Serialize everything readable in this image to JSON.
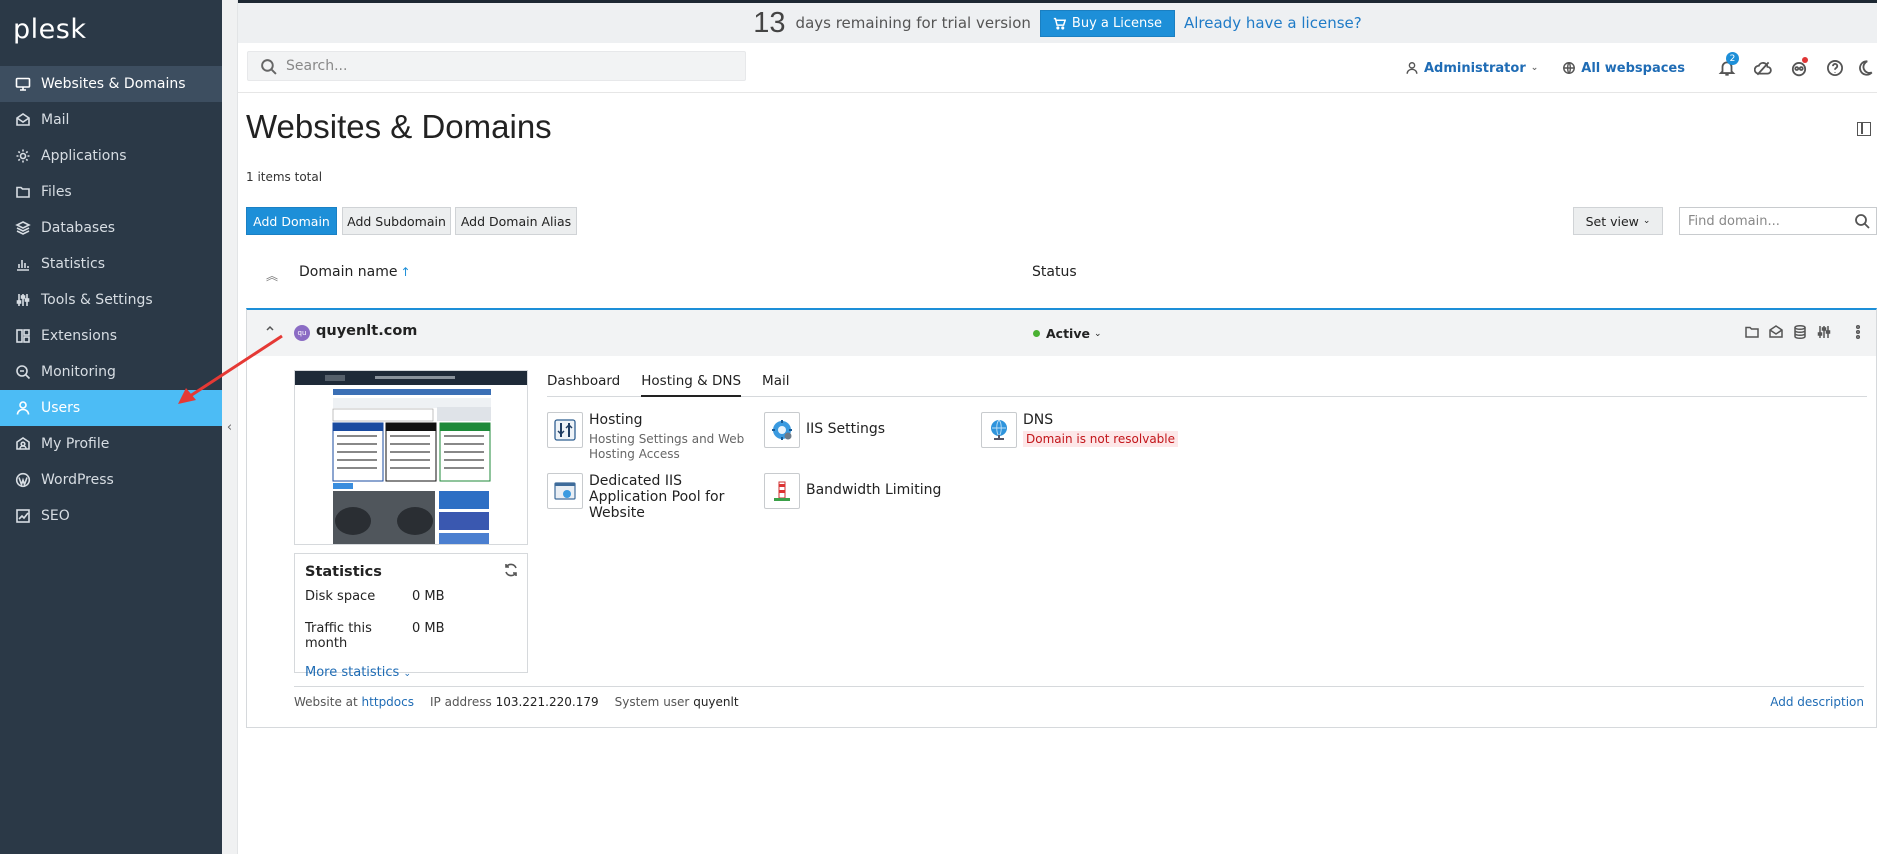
{
  "app": {
    "logo": "plesk"
  },
  "sidebar": {
    "items": [
      {
        "label": "Websites & Domains",
        "icon": "monitor-icon"
      },
      {
        "label": "Mail",
        "icon": "mail-icon"
      },
      {
        "label": "Applications",
        "icon": "gear-icon"
      },
      {
        "label": "Files",
        "icon": "folder-icon"
      },
      {
        "label": "Databases",
        "icon": "layers-icon"
      },
      {
        "label": "Statistics",
        "icon": "bar-chart-icon"
      },
      {
        "label": "Tools & Settings",
        "icon": "sliders-icon"
      },
      {
        "label": "Extensions",
        "icon": "grid-icon"
      },
      {
        "label": "Monitoring",
        "icon": "monitor-search-icon"
      },
      {
        "label": "Users",
        "icon": "user-icon"
      },
      {
        "label": "My Profile",
        "icon": "profile-icon"
      },
      {
        "label": "WordPress",
        "icon": "wordpress-icon"
      },
      {
        "label": "SEO",
        "icon": "trend-icon"
      }
    ]
  },
  "trial": {
    "days": "13",
    "text": "days remaining for trial version",
    "buy_label": "Buy a License",
    "have_license": "Already have a license?"
  },
  "header": {
    "search_placeholder": "Search...",
    "user": "Administrator",
    "webspaces": "All webspaces",
    "notifications_count": "2"
  },
  "main": {
    "title": "Websites & Domains",
    "items_total": "1 items total",
    "buttons": {
      "add_domain": "Add Domain",
      "add_subdomain": "Add Subdomain",
      "add_alias": "Add Domain Alias",
      "set_view": "Set view"
    },
    "find_placeholder": "Find domain...",
    "columns": {
      "domain": "Domain name",
      "status": "Status"
    }
  },
  "domain": {
    "favicon": "qu",
    "name": "quyenlt.com",
    "status": "Active",
    "tabs": [
      "Dashboard",
      "Hosting & DNS",
      "Mail"
    ],
    "active_tab": "Hosting & DNS",
    "tiles": {
      "hosting": {
        "title": "Hosting",
        "subtitle": "Hosting Settings and Web Hosting Access"
      },
      "iis": {
        "title": "IIS Settings"
      },
      "dns": {
        "title": "DNS",
        "warning": "Domain is not resolvable"
      },
      "pool": {
        "title": "Dedicated IIS Application Pool for Website"
      },
      "bandwidth": {
        "title": "Bandwidth Limiting"
      }
    },
    "statistics": {
      "title": "Statistics",
      "disk_label": "Disk space",
      "disk_value": "0 MB",
      "traffic_label": "Traffic this month",
      "traffic_value": "0 MB",
      "more": "More statistics"
    },
    "footer": {
      "website_at": "Website at",
      "docroot": "httpdocs",
      "ip_label": "IP address",
      "ip": "103.221.220.179",
      "sysuser_label": "System user",
      "sysuser": "quyenlt",
      "add_description": "Add description"
    }
  },
  "colors": {
    "accent": "#1d8fd8",
    "sidebar": "#2b3947",
    "highlight": "#4cbcf5",
    "arrow": "#e53935"
  }
}
